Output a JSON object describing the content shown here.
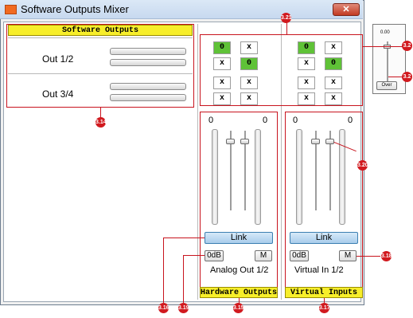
{
  "window": {
    "title": "Software Outputs Mixer",
    "close_glyph": "✕"
  },
  "software_outputs": {
    "header": "Software Outputs",
    "rows": [
      {
        "label": "Out 1/2"
      },
      {
        "label": "Out 3/4"
      }
    ]
  },
  "matrix": {
    "hardware": [
      [
        "0",
        "x",
        "x",
        "0"
      ],
      [
        "x",
        "x",
        "x",
        "x"
      ]
    ],
    "virtual": [
      [
        "0",
        "x",
        "x",
        "0"
      ],
      [
        "x",
        "x",
        "x",
        "x"
      ]
    ]
  },
  "hardware_strip": {
    "header": "Hardware Outputs",
    "name": "Analog Out 1/2",
    "left_level": "0",
    "right_level": "0",
    "link_label": "Link",
    "zero_db_label": "0dB",
    "mute_label": "M"
  },
  "virtual_strip": {
    "header": "Virtual Inputs",
    "name": "Virtual In 1/2",
    "left_level": "0",
    "right_level": "0",
    "link_label": "Link",
    "zero_db_label": "0dB",
    "mute_label": "M"
  },
  "mini_window": {
    "caption": "0.00",
    "button_label": "Over"
  },
  "callouts": [
    "3.14",
    "3.15",
    "3.16",
    "3.17",
    "3.18",
    "3.19",
    "3.2",
    "3.20",
    "3.21"
  ],
  "colors": {
    "header_yellow": "#f7ee2a",
    "active_green": "#5fc237",
    "callout_red": "#d11a1f"
  }
}
